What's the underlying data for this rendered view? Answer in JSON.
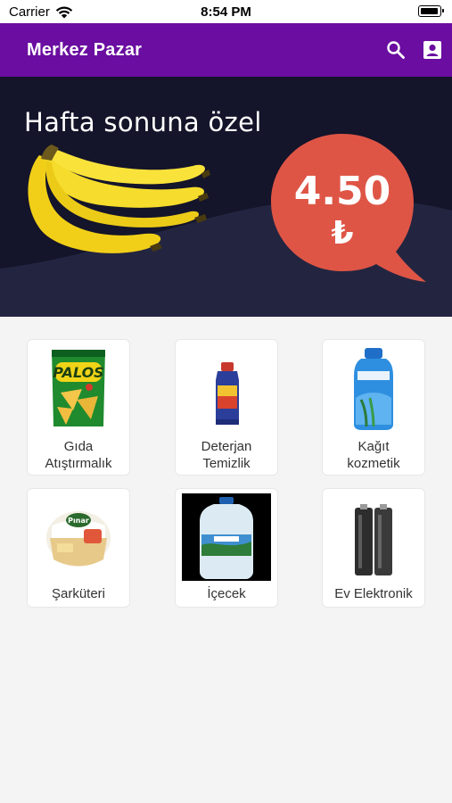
{
  "status_bar": {
    "carrier": "Carrier",
    "time": "8:54 PM"
  },
  "app_bar": {
    "title": "Merkez Pazar",
    "background_color": "#6a0da0",
    "actions": [
      {
        "icon": "search-icon"
      },
      {
        "icon": "account-box-icon"
      }
    ]
  },
  "banner": {
    "headline": "Hafta sonuna özel",
    "price": "4.50",
    "currency": "₺",
    "price_bubble_color": "#de5546",
    "product_image": "banana-bunch"
  },
  "categories": [
    {
      "label_line1": "Gıda",
      "label_line2": "Atıştırmalık",
      "image": "chips-bag"
    },
    {
      "label_line1": "Deterjan",
      "label_line2": "Temizlik",
      "image": "detergent-bottle"
    },
    {
      "label_line1": "Kağıt",
      "label_line2": "kozmetik",
      "image": "shampoo-bottle"
    },
    {
      "label_line1": "Şarküteri",
      "label_line2": "",
      "image": "cheese-package"
    },
    {
      "label_line1": "İçecek",
      "label_line2": "",
      "image": "water-bottle"
    },
    {
      "label_line1": "Ev Elektronik",
      "label_line2": "",
      "image": "batteries"
    }
  ]
}
